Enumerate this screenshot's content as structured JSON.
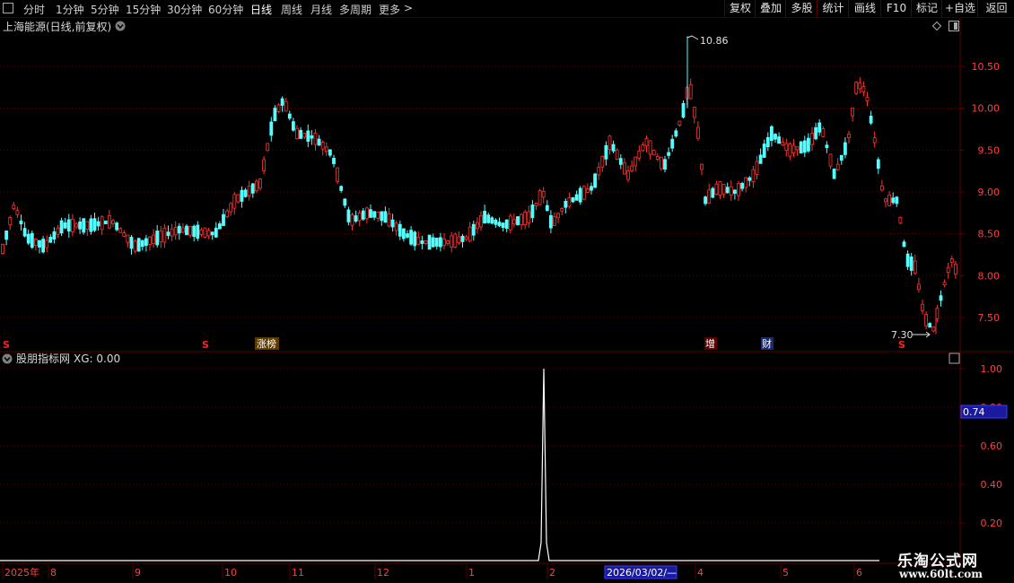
{
  "toolbar": {
    "periods": [
      "分时",
      "1分钟",
      "5分钟",
      "15分钟",
      "30分钟",
      "60分钟",
      "日线",
      "周线",
      "月线",
      "多周期",
      "更多"
    ],
    "active": "日线",
    "more_arrow": ">",
    "actions": [
      "复权",
      "叠加",
      "多股",
      "统计",
      "画线",
      "F10",
      "标记",
      "+自选",
      "返回"
    ]
  },
  "stock": {
    "title": "上海能源(日线,前复权)",
    "high_label": "10.86",
    "low_label": "7.30"
  },
  "price_axis": [
    "10.50",
    "10.00",
    "9.50",
    "9.00",
    "8.50",
    "8.00",
    "7.50"
  ],
  "markers": {
    "s": "S",
    "zhangbang": "涨榜",
    "zeng": "增",
    "cai": "财"
  },
  "indicator": {
    "name": "股朋指标网",
    "value_text": "XG: 0.00",
    "axis": [
      "1.00",
      "0.80",
      "0.60",
      "0.40",
      "0.20"
    ],
    "cursor_value": "0.74"
  },
  "time_axis": {
    "labels": [
      "2025年",
      "8",
      "9",
      "10",
      "11",
      "12",
      "1",
      "2",
      "3",
      "4",
      "5",
      "6"
    ],
    "cursor_date": "2026/03/02/—"
  },
  "watermark": {
    "line1": "乐淘公式网",
    "line2": "www.60lt.com"
  },
  "colors": {
    "up": "#ff3232",
    "down": "#54ffff",
    "grid": "#5a0000",
    "axis_text": "#ff4040",
    "cursor_bg": "#1a1aa0"
  }
}
